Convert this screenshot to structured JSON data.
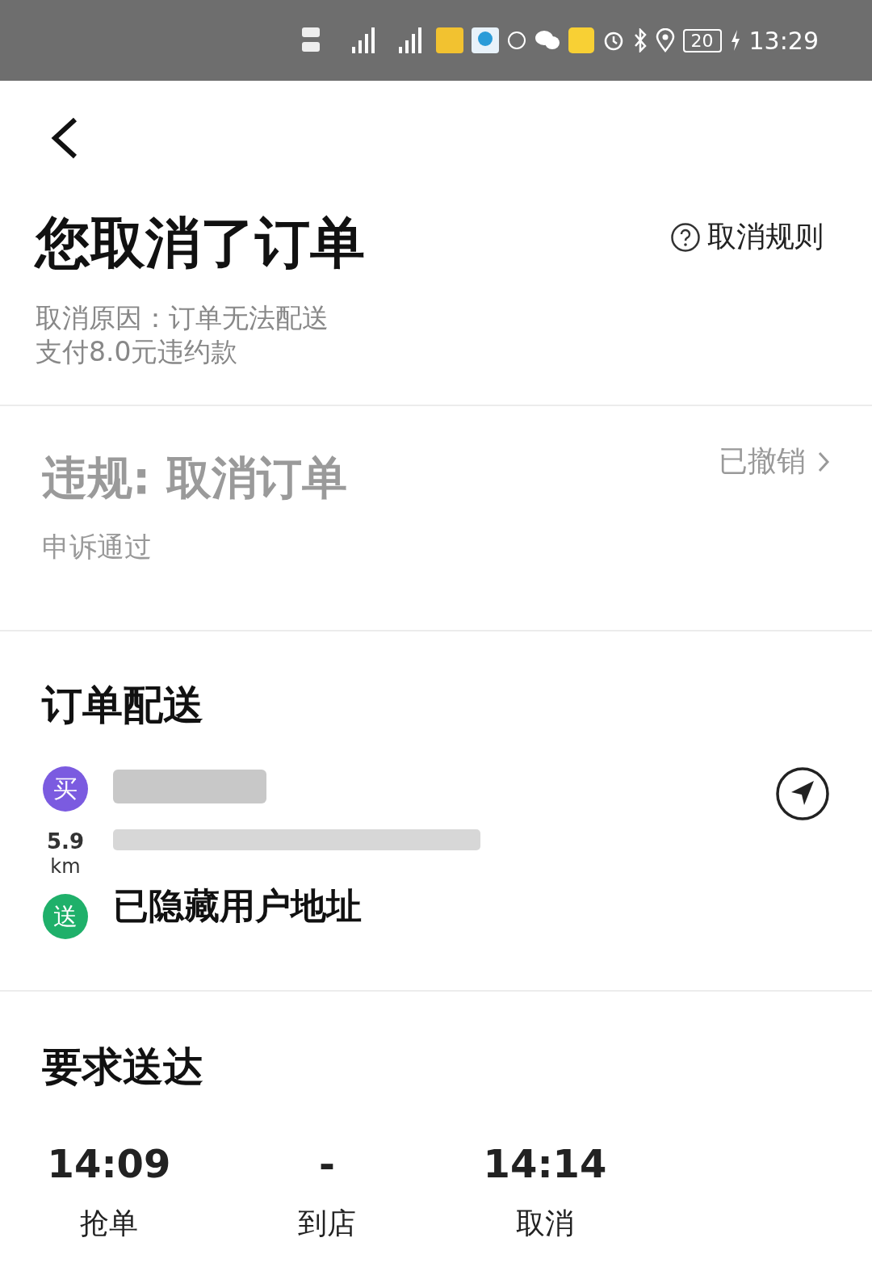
{
  "status_bar": {
    "battery": "20",
    "time": "13:29"
  },
  "header": {
    "title": "您取消了订单",
    "rules_link": "取消规则",
    "reason": "取消原因：订单无法配送",
    "penalty": "支付8.0元违约款"
  },
  "violation": {
    "title": "违规: 取消订单",
    "status": "已撤销",
    "appeal": "申诉通过"
  },
  "delivery": {
    "title": "订单配送",
    "pickup": {
      "badge": "买"
    },
    "distance": "5.9",
    "distance_unit": "km",
    "dropoff": {
      "badge": "送",
      "address": "已隐藏用户地址"
    }
  },
  "deadline": {
    "title": "要求送达",
    "steps": [
      {
        "time": "14:09",
        "label": "抢单"
      },
      {
        "time": "-",
        "label": "到店"
      },
      {
        "time": "14:14",
        "label": "取消"
      }
    ]
  }
}
